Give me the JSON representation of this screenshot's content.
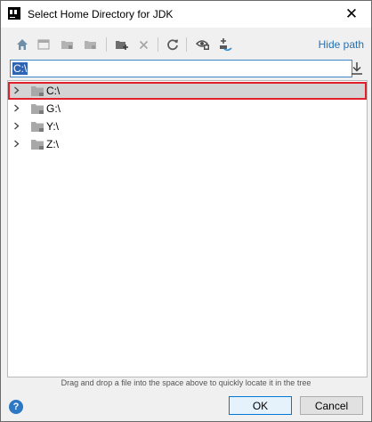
{
  "window": {
    "title": "Select Home Directory for JDK"
  },
  "toolbar": {
    "icons": [
      "home-icon",
      "desktop-icon",
      "project-folder-icon",
      "module-folder-icon",
      "new-folder-icon",
      "delete-icon",
      "refresh-icon",
      "show-hidden-icon",
      "jdk-icon"
    ],
    "hide_path_label": "Hide path"
  },
  "path": {
    "value": "C:\\"
  },
  "tree": {
    "items": [
      {
        "label": "C:\\",
        "selected": true
      },
      {
        "label": "G:\\",
        "selected": false
      },
      {
        "label": "Y:\\",
        "selected": false
      },
      {
        "label": "Z:\\",
        "selected": false
      }
    ]
  },
  "hint_text": "Drag and drop a file into the space above to quickly locate it in the tree",
  "buttons": {
    "help": "?",
    "ok": "OK",
    "cancel": "Cancel"
  },
  "colors": {
    "accent": "#2470b3",
    "selection_border": "#e0202a",
    "selection_bg": "#d4d4d4"
  }
}
